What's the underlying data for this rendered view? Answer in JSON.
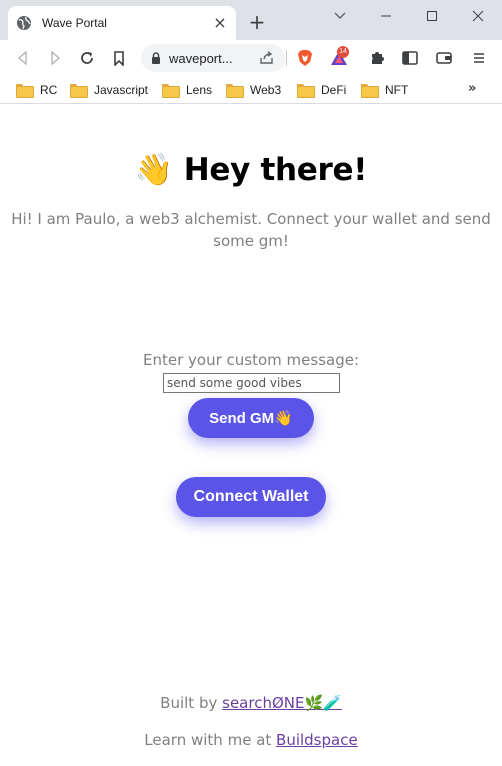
{
  "browser": {
    "tab_title": "Wave Portal",
    "tab_close": "×",
    "new_tab": "+",
    "url_display": "waveport...",
    "brave_badge": "14",
    "more_bookmarks": "»",
    "bookmarks": [
      "RC",
      "Javascript",
      "Lens",
      "Web3",
      "DeFi",
      "NFT"
    ]
  },
  "page": {
    "heading_emoji": "👋",
    "heading_text": "Hey there!",
    "bio": "Hi! I am Paulo, a web3 alchemist. Connect your wallet and send some gm!",
    "message_label": "Enter your custom message:",
    "message_value": "send some good vibes",
    "send_button": "Send GM👋",
    "connect_button": "Connect Wallet",
    "built_by_prefix": "Built by ",
    "built_by_link": "searchØNE🌿🧪",
    "learn_prefix": "Learn with me at ",
    "learn_link": "Buildspace"
  },
  "colors": {
    "accent": "#5b54e8",
    "muted_text": "#808080",
    "link": "#6a3fa0"
  }
}
